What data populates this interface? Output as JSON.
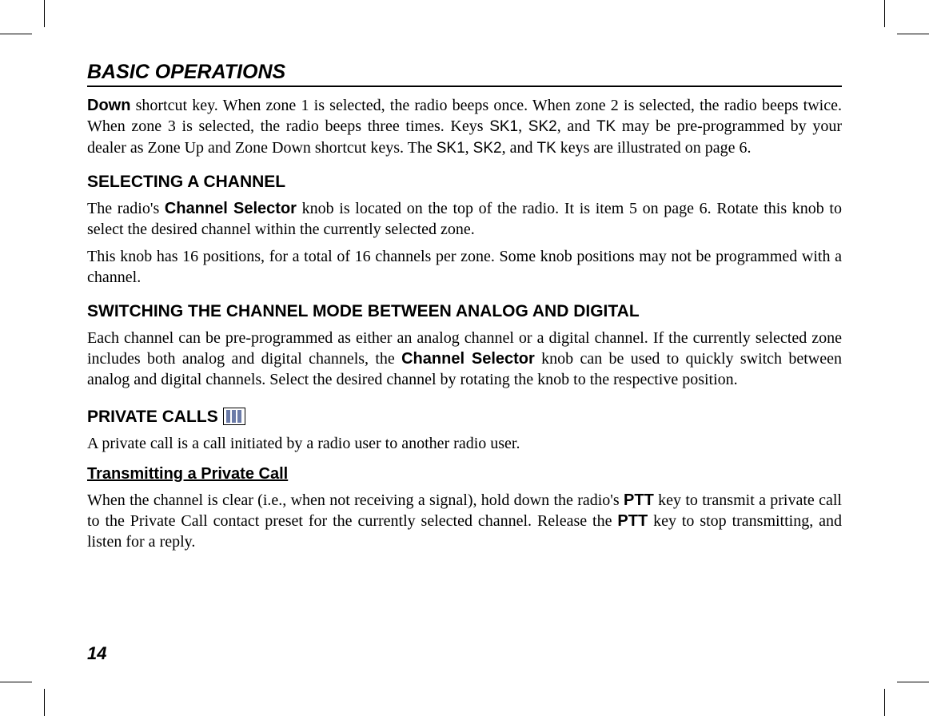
{
  "header": {
    "title": "BASIC OPERATIONS"
  },
  "intro_para": {
    "lead_bold": "Down",
    "text_part1": " shortcut key. When zone 1 is selected, the radio beeps once. When zone 2 is selected, the radio beeps twice. When zone 3 is selected, the radio beeps three times.  Keys ",
    "key1": "SK1",
    "comma1": ", ",
    "key2": "SK2",
    "comma2": ", and ",
    "key3": "TK",
    "text_part2": " may be pre-programmed by your dealer as Zone Up and Zone Down shortcut keys. The ",
    "key4": "SK1",
    "comma3": ", ",
    "key5": "SK2",
    "comma4": ", and ",
    "key6": "TK",
    "text_part3": " keys are illustrated on page 6."
  },
  "section1": {
    "heading": "SELECTING A CHANNEL",
    "para1_pre": "The radio's ",
    "para1_bold": "Channel Selector",
    "para1_post": " knob is located on the top of the radio. It is item 5 on page 6. Rotate this knob to select the desired channel within the currently selected zone.",
    "para2": "This knob has 16 positions, for a total of 16 channels per zone. Some knob positions may not be programmed with a channel."
  },
  "section2": {
    "heading": "SWITCHING THE CHANNEL MODE BETWEEN ANALOG AND DIGITAL",
    "para_pre": "Each channel can be pre-programmed as either an analog channel or a digital channel. If the currently selected zone includes both analog and digital channels, the ",
    "para_bold": "Channel Selector",
    "para_post": " knob can be used to quickly switch between analog and digital channels. Select the desired channel by rotating the knob to the respective position."
  },
  "section3": {
    "heading": "PRIVATE CALLS",
    "para": "A private call is a call initiated by a radio user to another radio user."
  },
  "subsection1": {
    "heading": "Transmitting a Private Call",
    "para_pre": "When the channel is clear (i.e., when not receiving a signal), hold down the radio's ",
    "para_bold1": "PTT",
    "para_mid": " key to transmit a private call to the Private Call contact preset for the currently selected channel. Release the ",
    "para_bold2": "PTT",
    "para_post": " key to stop transmitting, and listen for a reply."
  },
  "page_number": "14"
}
